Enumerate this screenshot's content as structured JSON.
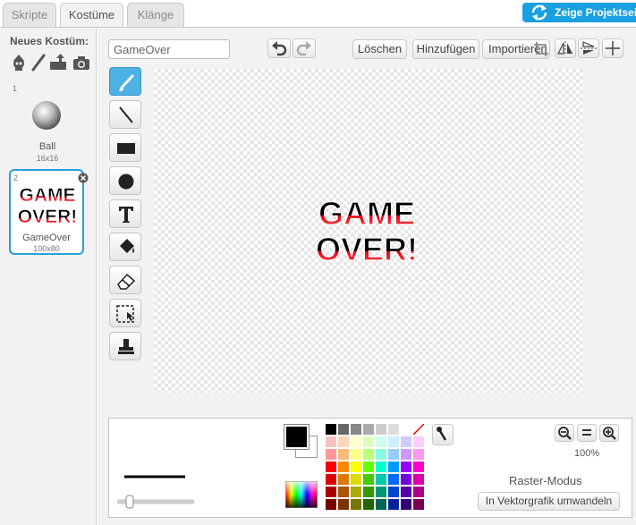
{
  "tabs": [
    {
      "label": "Skripte"
    },
    {
      "label": "Kostüme"
    },
    {
      "label": "Klänge"
    }
  ],
  "share_button_label": "Zeige Projektseite",
  "new_costume_label": "Neues Kostüm:",
  "new_costume_icons": [
    "sprite-library-icon",
    "paint-brush-icon",
    "upload-icon",
    "camera-icon"
  ],
  "costumes": [
    {
      "number": "1",
      "name": "Ball",
      "size": "16x16"
    },
    {
      "number": "2",
      "name": "GameOver",
      "size": "100x80",
      "selected": true
    }
  ],
  "costume_thumb_text": [
    "GAME",
    "OVER!"
  ],
  "editor": {
    "costume_name_value": "GameOver",
    "buttons": {
      "clear": "Löschen",
      "add": "Hinzufügen",
      "import": "Importieren"
    },
    "canvas_text": [
      "GAME",
      "OVER!"
    ],
    "tools": [
      "brush-tool",
      "line-tool",
      "rectangle-tool",
      "ellipse-tool",
      "text-tool",
      "fill-tool",
      "eraser-tool",
      "select-tool",
      "stamp-tool"
    ]
  },
  "palette": {
    "primary_color": "#000000",
    "secondary_color": "#ffffff",
    "zoom": "100%",
    "mode_label": "Raster-Modus",
    "convert_button": "In Vektorgrafik umwandeln",
    "colors": [
      [
        "#000000",
        "#666666",
        "#888888",
        "#aaaaaa",
        "#cccccc",
        "#dddddd",
        "#ffffff",
        "none"
      ],
      [
        "#f4c2c2",
        "#fcd5b4",
        "#ffffcc",
        "#ddffbb",
        "#ccffee",
        "#cceeff",
        "#ccccff",
        "#ffccff"
      ],
      [
        "#ff9999",
        "#ffbb77",
        "#ffff88",
        "#bbff77",
        "#88ffdd",
        "#99ccff",
        "#cc99ff",
        "#ff99ee"
      ],
      [
        "#ff0000",
        "#ff8800",
        "#ffff00",
        "#66ff00",
        "#00ffcc",
        "#0099ff",
        "#9900ff",
        "#ff00cc"
      ],
      [
        "#dd0000",
        "#dd7700",
        "#dddd00",
        "#44cc00",
        "#00ccaa",
        "#0066ff",
        "#7700dd",
        "#dd00aa"
      ],
      [
        "#aa0000",
        "#aa5500",
        "#aaaa00",
        "#339900",
        "#009977",
        "#0044cc",
        "#5500aa",
        "#aa0088"
      ],
      [
        "#770000",
        "#773300",
        "#777700",
        "#226600",
        "#006655",
        "#002299",
        "#330077",
        "#770055"
      ]
    ]
  }
}
